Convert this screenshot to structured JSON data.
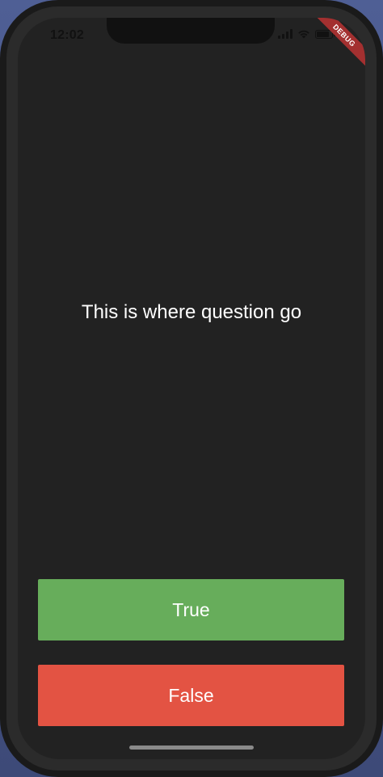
{
  "status_bar": {
    "time": "12:02",
    "icons": [
      "signal-icon",
      "wifi-icon",
      "battery-icon"
    ],
    "battery_level": 0.9
  },
  "debug_banner": {
    "label": "DEBUG",
    "color": "#a33030"
  },
  "quiz": {
    "question": "This is where question go",
    "true_label": "True",
    "false_label": "False"
  },
  "colors": {
    "background": "#222222",
    "true_button": "#67ad5b",
    "false_button": "#e35343",
    "text": "#ffffff"
  }
}
